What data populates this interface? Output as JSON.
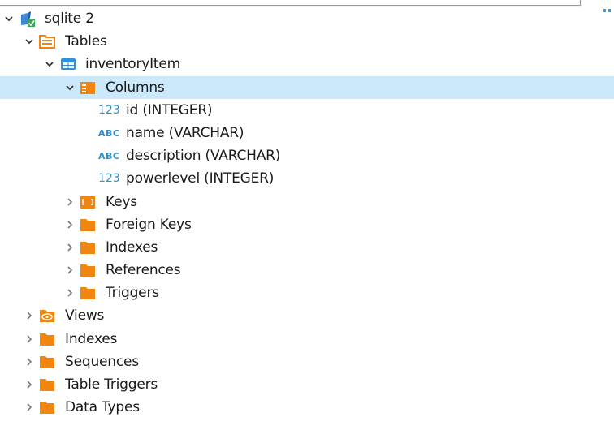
{
  "colors": {
    "selection": "#cce8fb",
    "folder": "#f0860f",
    "accent_blue": "#2f8fc9",
    "text": "#1a1a1a"
  },
  "filter_input": {
    "value": ""
  },
  "tree": {
    "connection": {
      "label": "sqlite 2",
      "icon": "sqlite-connection-icon",
      "expanded": true
    },
    "tables": {
      "label": "Tables",
      "icon": "tables-folder-icon",
      "expanded": true
    },
    "table": {
      "label": "inventoryItem",
      "icon": "table-icon",
      "expanded": true
    },
    "columns": {
      "label": "Columns",
      "icon": "columns-folder-icon",
      "expanded": true,
      "selected": true,
      "items": [
        {
          "type_badge": "123",
          "label": "id (INTEGER)",
          "icon": "numeric-column-icon"
        },
        {
          "type_badge": "ABC",
          "label": "name (VARCHAR)",
          "icon": "text-column-icon"
        },
        {
          "type_badge": "ABC",
          "label": "description (VARCHAR)",
          "icon": "text-column-icon"
        },
        {
          "type_badge": "123",
          "label": "powerlevel (INTEGER)",
          "icon": "numeric-column-icon"
        }
      ]
    },
    "table_children": [
      {
        "label": "Keys",
        "icon": "keys-icon"
      },
      {
        "label": "Foreign Keys",
        "icon": "folder-icon"
      },
      {
        "label": "Indexes",
        "icon": "folder-icon"
      },
      {
        "label": "References",
        "icon": "folder-icon"
      },
      {
        "label": "Triggers",
        "icon": "folder-icon"
      }
    ],
    "connection_children": [
      {
        "label": "Views",
        "icon": "views-icon"
      },
      {
        "label": "Indexes",
        "icon": "folder-icon"
      },
      {
        "label": "Sequences",
        "icon": "folder-icon"
      },
      {
        "label": "Table Triggers",
        "icon": "folder-icon"
      },
      {
        "label": "Data Types",
        "icon": "folder-icon"
      }
    ]
  }
}
